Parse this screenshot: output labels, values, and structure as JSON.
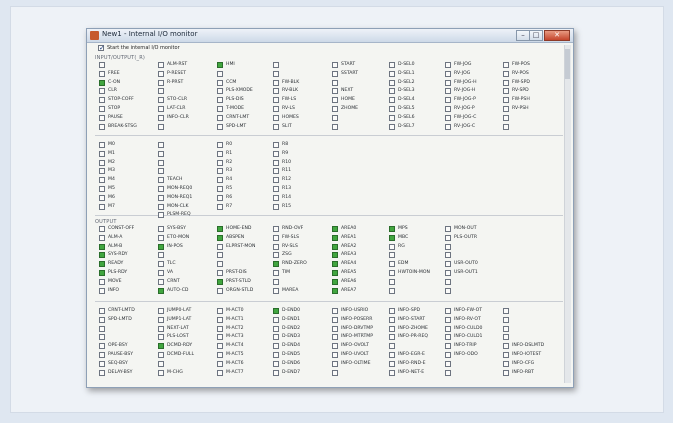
{
  "window": {
    "title": "New1 - Internal I/O monitor",
    "min_glyph": "–",
    "max_glyph": "□",
    "close_glyph": "✕",
    "app_icon": "app-icon"
  },
  "start_monitor": {
    "label": "Start the internal I/O monitor",
    "checked": true
  },
  "sections": {
    "input": "INPUT/OUTPUT(_R)",
    "output": "OUTPUT"
  },
  "colors": {
    "on": "#41a63f",
    "off": "#fbfbfa"
  },
  "group1": {
    "columns": [
      [
        {
          "label": "",
          "on": false
        },
        {
          "label": "FREE",
          "on": false
        },
        {
          "label": "C-ON",
          "on": true
        },
        {
          "label": "CLR",
          "on": false
        },
        {
          "label": "STOP-COFF",
          "on": false
        },
        {
          "label": "STOP",
          "on": false
        },
        {
          "label": "PAUSE",
          "on": false
        },
        {
          "label": "BREAK-STSG",
          "on": false
        }
      ],
      [
        {
          "label": "ALM-RST",
          "on": false
        },
        {
          "label": "P-RESET",
          "on": false
        },
        {
          "label": "R-PRST",
          "on": false
        },
        {
          "label": "",
          "on": false
        },
        {
          "label": "STO-CLR",
          "on": false
        },
        {
          "label": "LAT-CLR",
          "on": false
        },
        {
          "label": "INFO-CLR",
          "on": false
        },
        {
          "label": "",
          "on": false
        }
      ],
      [
        {
          "label": "HMI",
          "on": true
        },
        {
          "label": "",
          "on": false
        },
        {
          "label": "CCM",
          "on": false
        },
        {
          "label": "PLS-XMODE",
          "on": false
        },
        {
          "label": "PLS-DIS",
          "on": false
        },
        {
          "label": "T-MODE",
          "on": false
        },
        {
          "label": "CRNT-LMT",
          "on": false
        },
        {
          "label": "SPD-LMT",
          "on": false
        }
      ],
      [
        {
          "label": "",
          "on": false
        },
        {
          "label": "",
          "on": false
        },
        {
          "label": "FW-BLK",
          "on": false
        },
        {
          "label": "RV-BLK",
          "on": false
        },
        {
          "label": "FW-LS",
          "on": false
        },
        {
          "label": "RV-LS",
          "on": false
        },
        {
          "label": "HOMES",
          "on": false
        },
        {
          "label": "SLIT",
          "on": false
        }
      ],
      [
        {
          "label": "START",
          "on": false
        },
        {
          "label": "SSTART",
          "on": false
        },
        {
          "label": "",
          "on": false
        },
        {
          "label": "NEXT",
          "on": false
        },
        {
          "label": "HOME",
          "on": false
        },
        {
          "label": "ZHOME",
          "on": false
        },
        {
          "label": "",
          "on": false
        },
        {
          "label": "",
          "on": false
        }
      ],
      [
        {
          "label": "D-SEL0",
          "on": false
        },
        {
          "label": "D-SEL1",
          "on": false
        },
        {
          "label": "D-SEL2",
          "on": false
        },
        {
          "label": "D-SEL3",
          "on": false
        },
        {
          "label": "D-SEL4",
          "on": false
        },
        {
          "label": "D-SEL5",
          "on": false
        },
        {
          "label": "D-SEL6",
          "on": false
        },
        {
          "label": "D-SEL7",
          "on": false
        }
      ],
      [
        {
          "label": "FW-JOG",
          "on": false
        },
        {
          "label": "RV-JOG",
          "on": false
        },
        {
          "label": "FW-JOG-H",
          "on": false
        },
        {
          "label": "RV-JOG-H",
          "on": false
        },
        {
          "label": "FW-JOG-P",
          "on": false
        },
        {
          "label": "RV-JOG-P",
          "on": false
        },
        {
          "label": "FW-JOG-C",
          "on": false
        },
        {
          "label": "RV-JOG-C",
          "on": false
        }
      ],
      [
        {
          "label": "FW-POS",
          "on": false
        },
        {
          "label": "RV-POS",
          "on": false
        },
        {
          "label": "FW-SPD",
          "on": false
        },
        {
          "label": "RV-SPD",
          "on": false
        },
        {
          "label": "FW-PSH",
          "on": false
        },
        {
          "label": "RV-PSH",
          "on": false
        },
        {
          "label": "",
          "on": false
        },
        {
          "label": "",
          "on": false
        }
      ]
    ]
  },
  "group2": {
    "columns": [
      [
        {
          "label": "M0",
          "on": false
        },
        {
          "label": "M1",
          "on": false
        },
        {
          "label": "M2",
          "on": false
        },
        {
          "label": "M3",
          "on": false
        },
        {
          "label": "M4",
          "on": false
        },
        {
          "label": "M5",
          "on": false
        },
        {
          "label": "M6",
          "on": false
        },
        {
          "label": "M7",
          "on": false
        }
      ],
      [
        {
          "label": "",
          "on": false
        },
        {
          "label": "",
          "on": false
        },
        {
          "label": "",
          "on": false
        },
        {
          "label": "",
          "on": false
        },
        {
          "label": "TEACH",
          "on": false
        },
        {
          "label": "MON-REQ0",
          "on": false
        },
        {
          "label": "MON-REQ1",
          "on": false
        },
        {
          "label": "MON-CLK",
          "on": false
        },
        {
          "label": "PLSM-REQ",
          "on": false
        }
      ],
      [
        {
          "label": "R0",
          "on": false
        },
        {
          "label": "R1",
          "on": false
        },
        {
          "label": "R2",
          "on": false
        },
        {
          "label": "R3",
          "on": false
        },
        {
          "label": "R4",
          "on": false
        },
        {
          "label": "R5",
          "on": false
        },
        {
          "label": "R6",
          "on": false
        },
        {
          "label": "R7",
          "on": false
        }
      ],
      [
        {
          "label": "R8",
          "on": false
        },
        {
          "label": "R9",
          "on": false
        },
        {
          "label": "R10",
          "on": false
        },
        {
          "label": "R11",
          "on": false
        },
        {
          "label": "R12",
          "on": false
        },
        {
          "label": "R13",
          "on": false
        },
        {
          "label": "R14",
          "on": false
        },
        {
          "label": "R15",
          "on": false
        }
      ]
    ]
  },
  "group3": {
    "columns": [
      [
        {
          "label": "CONST-OFF",
          "on": false
        },
        {
          "label": "ALM-A",
          "on": false
        },
        {
          "label": "ALM-B",
          "on": true
        },
        {
          "label": "SYS-RDY",
          "on": true
        },
        {
          "label": "READY",
          "on": true
        },
        {
          "label": "PLS-RDY",
          "on": true
        },
        {
          "label": "MOVE",
          "on": false
        },
        {
          "label": "INFO",
          "on": false
        }
      ],
      [
        {
          "label": "SYS-BSY",
          "on": false
        },
        {
          "label": "ETO-MON",
          "on": false
        },
        {
          "label": "IN-POS",
          "on": true
        },
        {
          "label": "",
          "on": false
        },
        {
          "label": "TLC",
          "on": false
        },
        {
          "label": "VA",
          "on": false
        },
        {
          "label": "CRNT",
          "on": false
        },
        {
          "label": "AUTO-CD",
          "on": true
        }
      ],
      [
        {
          "label": "HOME-END",
          "on": true
        },
        {
          "label": "ABSPEN",
          "on": true
        },
        {
          "label": "ELPRST-MON",
          "on": false
        },
        {
          "label": "",
          "on": false
        },
        {
          "label": "",
          "on": false
        },
        {
          "label": "PRST-DIS",
          "on": false
        },
        {
          "label": "PRST-STLD",
          "on": true
        },
        {
          "label": "ORGN-STLD",
          "on": false
        }
      ],
      [
        {
          "label": "RND-OVF",
          "on": false
        },
        {
          "label": "FW-SLS",
          "on": false
        },
        {
          "label": "RV-SLS",
          "on": false
        },
        {
          "label": "ZSG",
          "on": false
        },
        {
          "label": "RND-ZERO",
          "on": true
        },
        {
          "label": "TIM",
          "on": false
        },
        {
          "label": "",
          "on": false
        },
        {
          "label": "MAREA",
          "on": false
        }
      ],
      [
        {
          "label": "AREA0",
          "on": true
        },
        {
          "label": "AREA1",
          "on": true
        },
        {
          "label": "AREA2",
          "on": true
        },
        {
          "label": "AREA3",
          "on": true
        },
        {
          "label": "AREA4",
          "on": true
        },
        {
          "label": "AREA5",
          "on": true
        },
        {
          "label": "AREA6",
          "on": true
        },
        {
          "label": "AREA7",
          "on": true
        }
      ],
      [
        {
          "label": "MPS",
          "on": true
        },
        {
          "label": "MBC",
          "on": true
        },
        {
          "label": "RG",
          "on": false
        },
        {
          "label": "",
          "on": false
        },
        {
          "label": "EDM",
          "on": false
        },
        {
          "label": "HWTOIN-MON",
          "on": false
        },
        {
          "label": "",
          "on": false
        },
        {
          "label": "",
          "on": false
        }
      ],
      [
        {
          "label": "MON-OUT",
          "on": false
        },
        {
          "label": "PLS-OUTR",
          "on": false
        },
        {
          "label": "",
          "on": false
        },
        {
          "label": "",
          "on": false
        },
        {
          "label": "USR-OUT0",
          "on": false
        },
        {
          "label": "USR-OUT1",
          "on": false
        },
        {
          "label": "",
          "on": false
        },
        {
          "label": "",
          "on": false
        }
      ]
    ]
  },
  "group4": {
    "columns": [
      [
        {
          "label": "CRNT-LMTD",
          "on": false
        },
        {
          "label": "SPD-LMTD",
          "on": false
        },
        {
          "label": "",
          "on": false
        },
        {
          "label": "",
          "on": false
        },
        {
          "label": "OPE-BSY",
          "on": false
        },
        {
          "label": "PAUSE-BSY",
          "on": false
        },
        {
          "label": "SEQ-BSY",
          "on": false
        },
        {
          "label": "DELAY-BSY",
          "on": false
        }
      ],
      [
        {
          "label": "JUMP0-LAT",
          "on": false
        },
        {
          "label": "JUMP1-LAT",
          "on": false
        },
        {
          "label": "NEXT-LAT",
          "on": false
        },
        {
          "label": "PLS-LOST",
          "on": false
        },
        {
          "label": "DCMD-RDY",
          "on": true
        },
        {
          "label": "DCMD-FULL",
          "on": false
        },
        {
          "label": "",
          "on": false
        },
        {
          "label": "M-CHG",
          "on": false
        }
      ],
      [
        {
          "label": "M-ACT0",
          "on": false
        },
        {
          "label": "M-ACT1",
          "on": false
        },
        {
          "label": "M-ACT2",
          "on": false
        },
        {
          "label": "M-ACT3",
          "on": false
        },
        {
          "label": "M-ACT4",
          "on": false
        },
        {
          "label": "M-ACT5",
          "on": false
        },
        {
          "label": "M-ACT6",
          "on": false
        },
        {
          "label": "M-ACT7",
          "on": false
        }
      ],
      [
        {
          "label": "D-END0",
          "on": true
        },
        {
          "label": "D-END1",
          "on": false
        },
        {
          "label": "D-END2",
          "on": false
        },
        {
          "label": "D-END3",
          "on": false
        },
        {
          "label": "D-END4",
          "on": false
        },
        {
          "label": "D-END5",
          "on": false
        },
        {
          "label": "D-END6",
          "on": false
        },
        {
          "label": "D-END7",
          "on": false
        }
      ],
      [
        {
          "label": "INFO-USRIO",
          "on": false
        },
        {
          "label": "INFO-POSERR",
          "on": false
        },
        {
          "label": "INFO-DRVTMP",
          "on": false
        },
        {
          "label": "INFO-MTRTMP",
          "on": false
        },
        {
          "label": "INFO-OVOLT",
          "on": false
        },
        {
          "label": "INFO-UVOLT",
          "on": false
        },
        {
          "label": "INFO-OLTIME",
          "on": false
        },
        {
          "label": "",
          "on": false
        }
      ],
      [
        {
          "label": "INFO-SPD",
          "on": false
        },
        {
          "label": "INFO-START",
          "on": false
        },
        {
          "label": "INFO-ZHOME",
          "on": false
        },
        {
          "label": "INFO-PR-REQ",
          "on": false
        },
        {
          "label": "",
          "on": false
        },
        {
          "label": "INFO-EGR-E",
          "on": false
        },
        {
          "label": "INFO-RND-E",
          "on": false
        },
        {
          "label": "INFO-NET-E",
          "on": false
        }
      ],
      [
        {
          "label": "INFO-FW-OT",
          "on": false
        },
        {
          "label": "INFO-RV-OT",
          "on": false
        },
        {
          "label": "INFO-CULD0",
          "on": false
        },
        {
          "label": "INFO-CULD1",
          "on": false
        },
        {
          "label": "INFO-TRIP",
          "on": false
        },
        {
          "label": "INFO-ODO",
          "on": false
        },
        {
          "label": "",
          "on": false
        },
        {
          "label": "",
          "on": false
        }
      ],
      [
        {
          "label": "",
          "on": false
        },
        {
          "label": "",
          "on": false
        },
        {
          "label": "",
          "on": false
        },
        {
          "label": "",
          "on": false
        },
        {
          "label": "INFO-DSLMTD",
          "on": false
        },
        {
          "label": "INFO-IOTEST",
          "on": false
        },
        {
          "label": "INFO-CFG",
          "on": false
        },
        {
          "label": "INFO-RBT",
          "on": false
        }
      ]
    ]
  }
}
